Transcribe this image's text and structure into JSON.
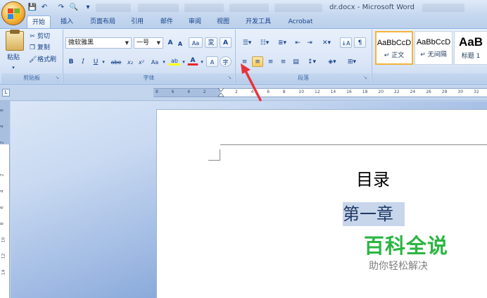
{
  "window": {
    "title": "dr.docx - Microsoft Word",
    "blurred_tabs": [
      "",
      "",
      "",
      "",
      "",
      ""
    ]
  },
  "quick_access": {
    "save": "💾",
    "undo": "↶",
    "redo": "↷",
    "customize": "▾"
  },
  "ribbon_tabs": [
    "开始",
    "插入",
    "页面布局",
    "引用",
    "邮件",
    "审阅",
    "视图",
    "开发工具",
    "Acrobat"
  ],
  "clipboard": {
    "paste": "粘贴",
    "cut": "剪切",
    "copy": "复制",
    "format_painter": "格式刷",
    "label": "剪贴板"
  },
  "font": {
    "family": "微软雅黑",
    "size": "一号",
    "grow": "A",
    "shrink": "A",
    "clear": "Aa",
    "phonetic": "変",
    "border": "A",
    "bold": "B",
    "italic": "I",
    "underline": "U",
    "strike": "abe",
    "subscript": "x₂",
    "superscript": "x²",
    "case": "Aa",
    "highlight": "ab",
    "color": "A",
    "enclose": "字",
    "label": "字体"
  },
  "paragraph": {
    "label": "段落"
  },
  "styles": [
    {
      "sample": "AaBbCcD",
      "name": "↵ 正文"
    },
    {
      "sample": "AaBbCcD",
      "name": "↵ 无间隔"
    },
    {
      "sample": "AaB",
      "name": "标题 1"
    }
  ],
  "ruler": {
    "h_labels": [
      "8",
      "6",
      "4",
      "2",
      "",
      "2",
      "4",
      "6",
      "8",
      "10",
      "12",
      "14",
      "16",
      "18",
      "20",
      "22",
      "24",
      "26",
      "28",
      "30",
      "32"
    ],
    "v_labels": [
      "6",
      "4",
      "2",
      "",
      "2",
      "4",
      "6",
      "8",
      "10",
      "12",
      "14"
    ],
    "toggle": "L"
  },
  "document": {
    "toc_title": "目录",
    "heading_1": "第一章"
  },
  "watermark": {
    "title": "百科全说",
    "subtitle": "助你轻松解决"
  },
  "colors": {
    "accent_red_arrow": "#e8333a",
    "watermark_green": "#2bb542",
    "ribbon_blue": "#dbe6f7"
  }
}
